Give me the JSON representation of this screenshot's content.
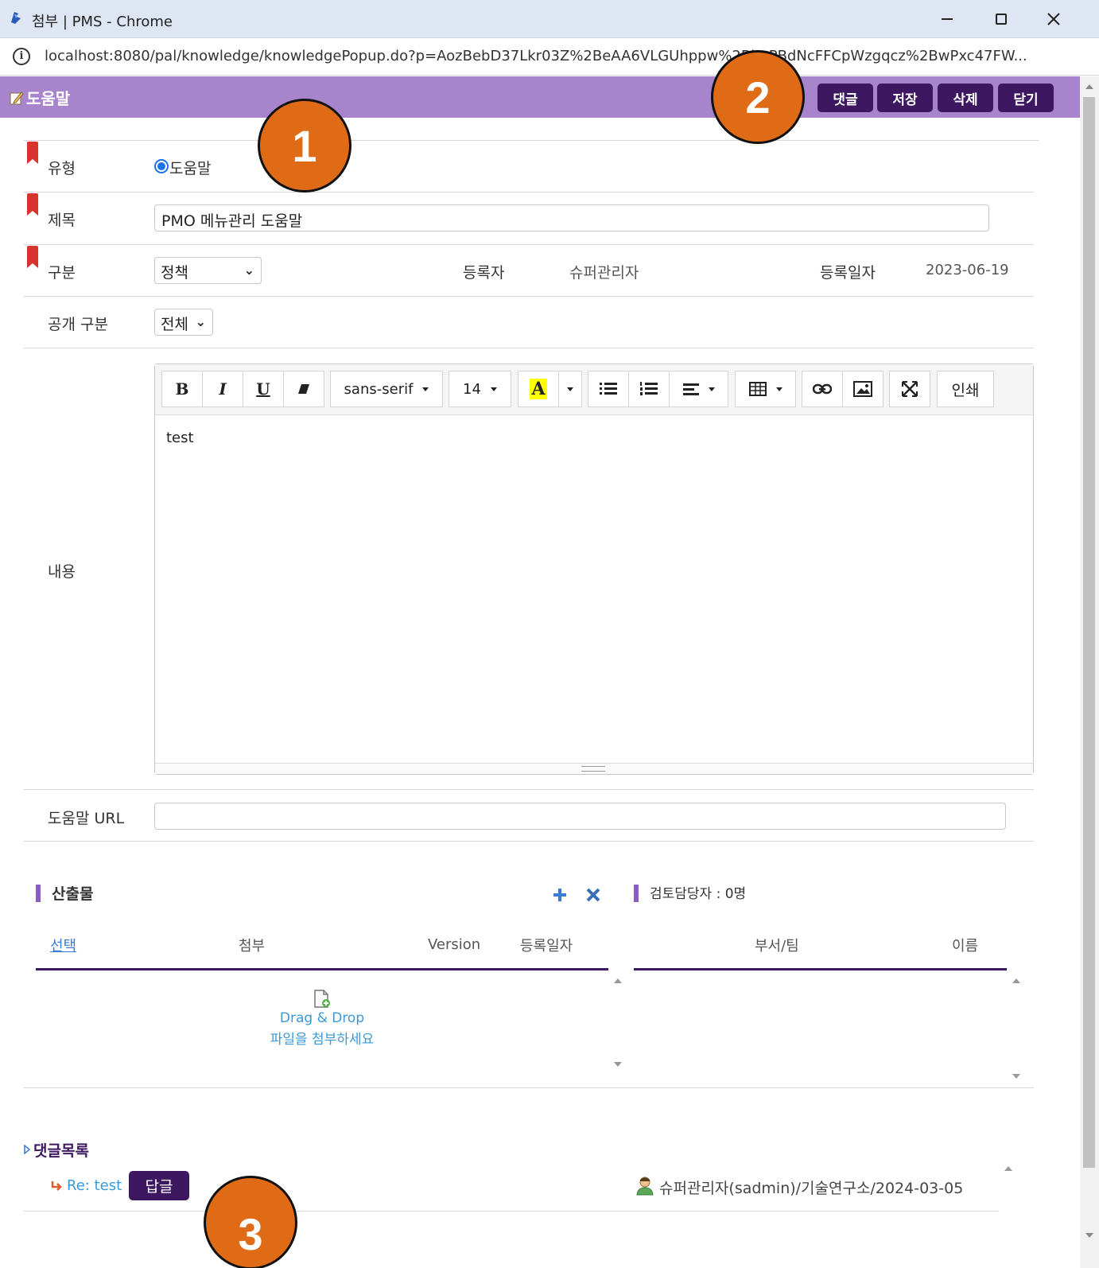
{
  "window": {
    "title": "첨부 | PMS - Chrome",
    "url": "localhost:8080/pal/knowledge/knowledgePopup.do?p=AozBebD37Lkr03Z%2BeAA6VLGUhppw%2BbePBdNcFFCpWzgqcz%2BwPxc47FW..."
  },
  "header": {
    "title": "도움말",
    "buttons": {
      "comment": "댓글",
      "save": "저장",
      "delete": "삭제",
      "close": "닫기"
    }
  },
  "form": {
    "type_label": "유형",
    "type_option": "도움말",
    "subject_label": "제목",
    "subject_value": "PMO 메뉴관리 도움말",
    "category_label": "구분",
    "category_value": "정책",
    "registrant_label": "등록자",
    "registrant_value": "슈퍼관리자",
    "reg_date_label": "등록일자",
    "reg_date_value": "2023-06-19",
    "public_label": "공개 구분",
    "public_value": "전체",
    "content_label": "내용",
    "content_value": "test",
    "help_url_label": "도움말 URL",
    "help_url_value": ""
  },
  "editor": {
    "font_family": "sans-serif",
    "font_size": "14",
    "print_label": "인쇄",
    "highlight_color": "#ffff00"
  },
  "outputs": {
    "title": "산출물",
    "columns": [
      "선택",
      "첨부",
      "Version",
      "등록일자"
    ],
    "drop_line1": "Drag & Drop",
    "drop_line2": "파일을 첨부하세요"
  },
  "reviewers": {
    "title": "검토담당자 : 0명",
    "columns": [
      "부서/팀",
      "이름"
    ]
  },
  "comments": {
    "title": "댓글목록",
    "item_title": "Re: test",
    "reply_label": "답글",
    "meta": "슈퍼관리자(sadmin)/기술연구소/2024-03-05"
  },
  "annotations": [
    "1",
    "2",
    "3"
  ],
  "colors": {
    "header_bg": "#a884cc",
    "button_bg": "#3d1860",
    "annotation": "#e06b17"
  }
}
